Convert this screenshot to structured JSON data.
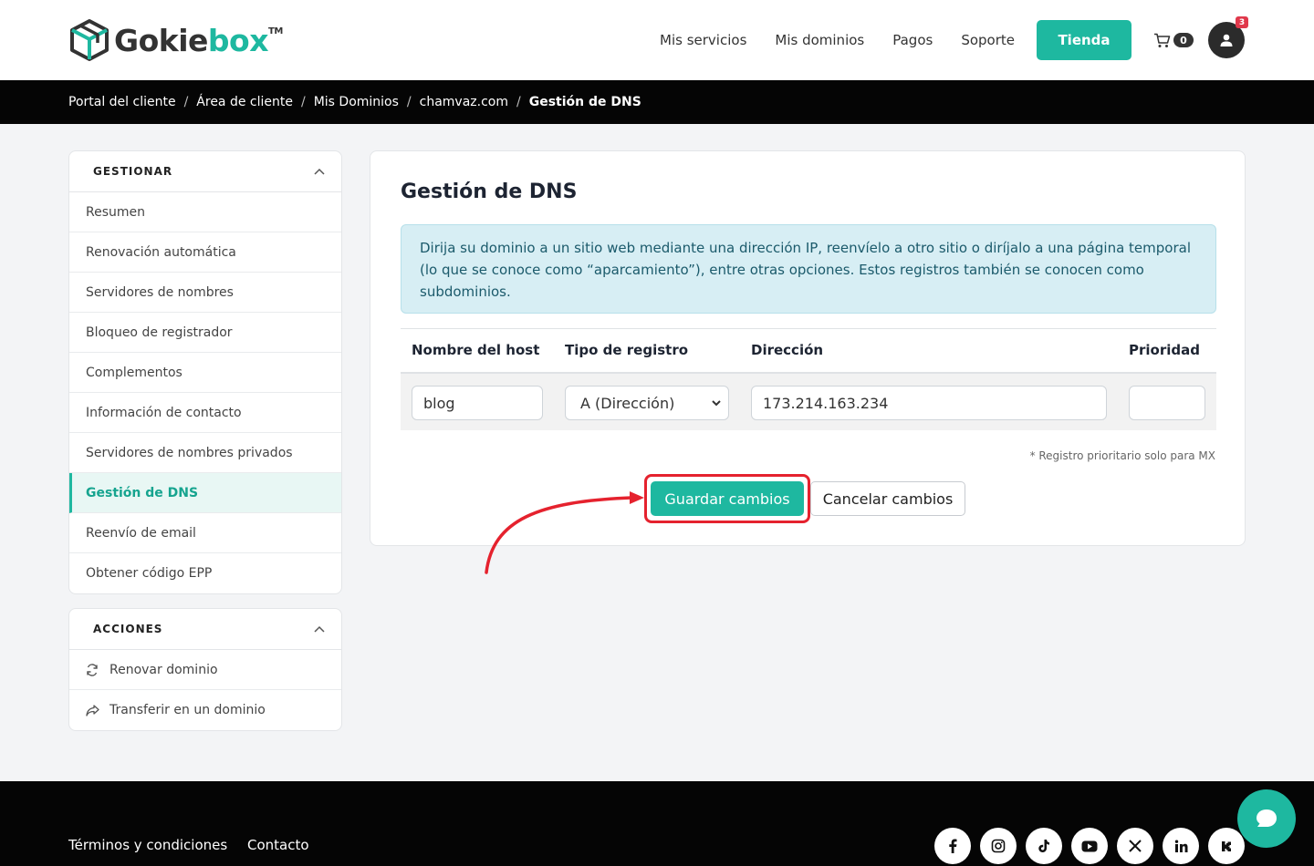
{
  "brand": {
    "name_part1": "Gokie",
    "name_part2": "box",
    "trademark": "TM"
  },
  "nav": {
    "links": [
      "Mis servicios",
      "Mis dominios",
      "Pagos",
      "Soporte"
    ],
    "store_button": "Tienda",
    "cart_count": "0",
    "notifications": "3"
  },
  "breadcrumb": [
    "Portal del cliente",
    "Área de cliente",
    "Mis Dominios",
    "chamvaz.com",
    "Gestión de DNS"
  ],
  "sidebar": {
    "manage_title": "GESTIONAR",
    "manage_items": [
      "Resumen",
      "Renovación automática",
      "Servidores de nombres",
      "Bloqueo de registrador",
      "Complementos",
      "Información de contacto",
      "Servidores de nombres privados",
      "Gestión de DNS",
      "Reenvío de email",
      "Obtener código EPP"
    ],
    "active_item": "Gestión de DNS",
    "actions_title": "ACCIONES",
    "action_items": [
      {
        "label": "Renovar dominio",
        "icon": "refresh-icon"
      },
      {
        "label": "Transferir en un dominio",
        "icon": "share-arrow-icon"
      }
    ]
  },
  "main": {
    "title": "Gestión de DNS",
    "info": "Dirija su dominio a un sitio web mediante una dirección IP, reenvíelo a otro sitio o diríjalo a una página temporal (lo que se conoce como “aparcamiento”), entre otras opciones. Estos registros también se conocen como subdominios.",
    "columns": [
      "Nombre del host",
      "Tipo de registro",
      "Dirección",
      "Prioridad"
    ],
    "row": {
      "host": "blog",
      "type": "A (Dirección)",
      "address": "173.214.163.234",
      "priority": ""
    },
    "priority_note": "* Registro prioritario solo para MX",
    "save_button": "Guardar cambios",
    "cancel_button": "Cancelar cambios"
  },
  "footer": {
    "links": [
      "Términos y condiciones",
      "Contacto"
    ],
    "socials": [
      "facebook-icon",
      "instagram-icon",
      "tiktok-icon",
      "youtube-icon",
      "x-icon",
      "linkedin-icon",
      "kick-icon"
    ]
  },
  "colors": {
    "accent": "#1eb8a0",
    "highlight": "#e5222e",
    "dark": "#050505"
  }
}
